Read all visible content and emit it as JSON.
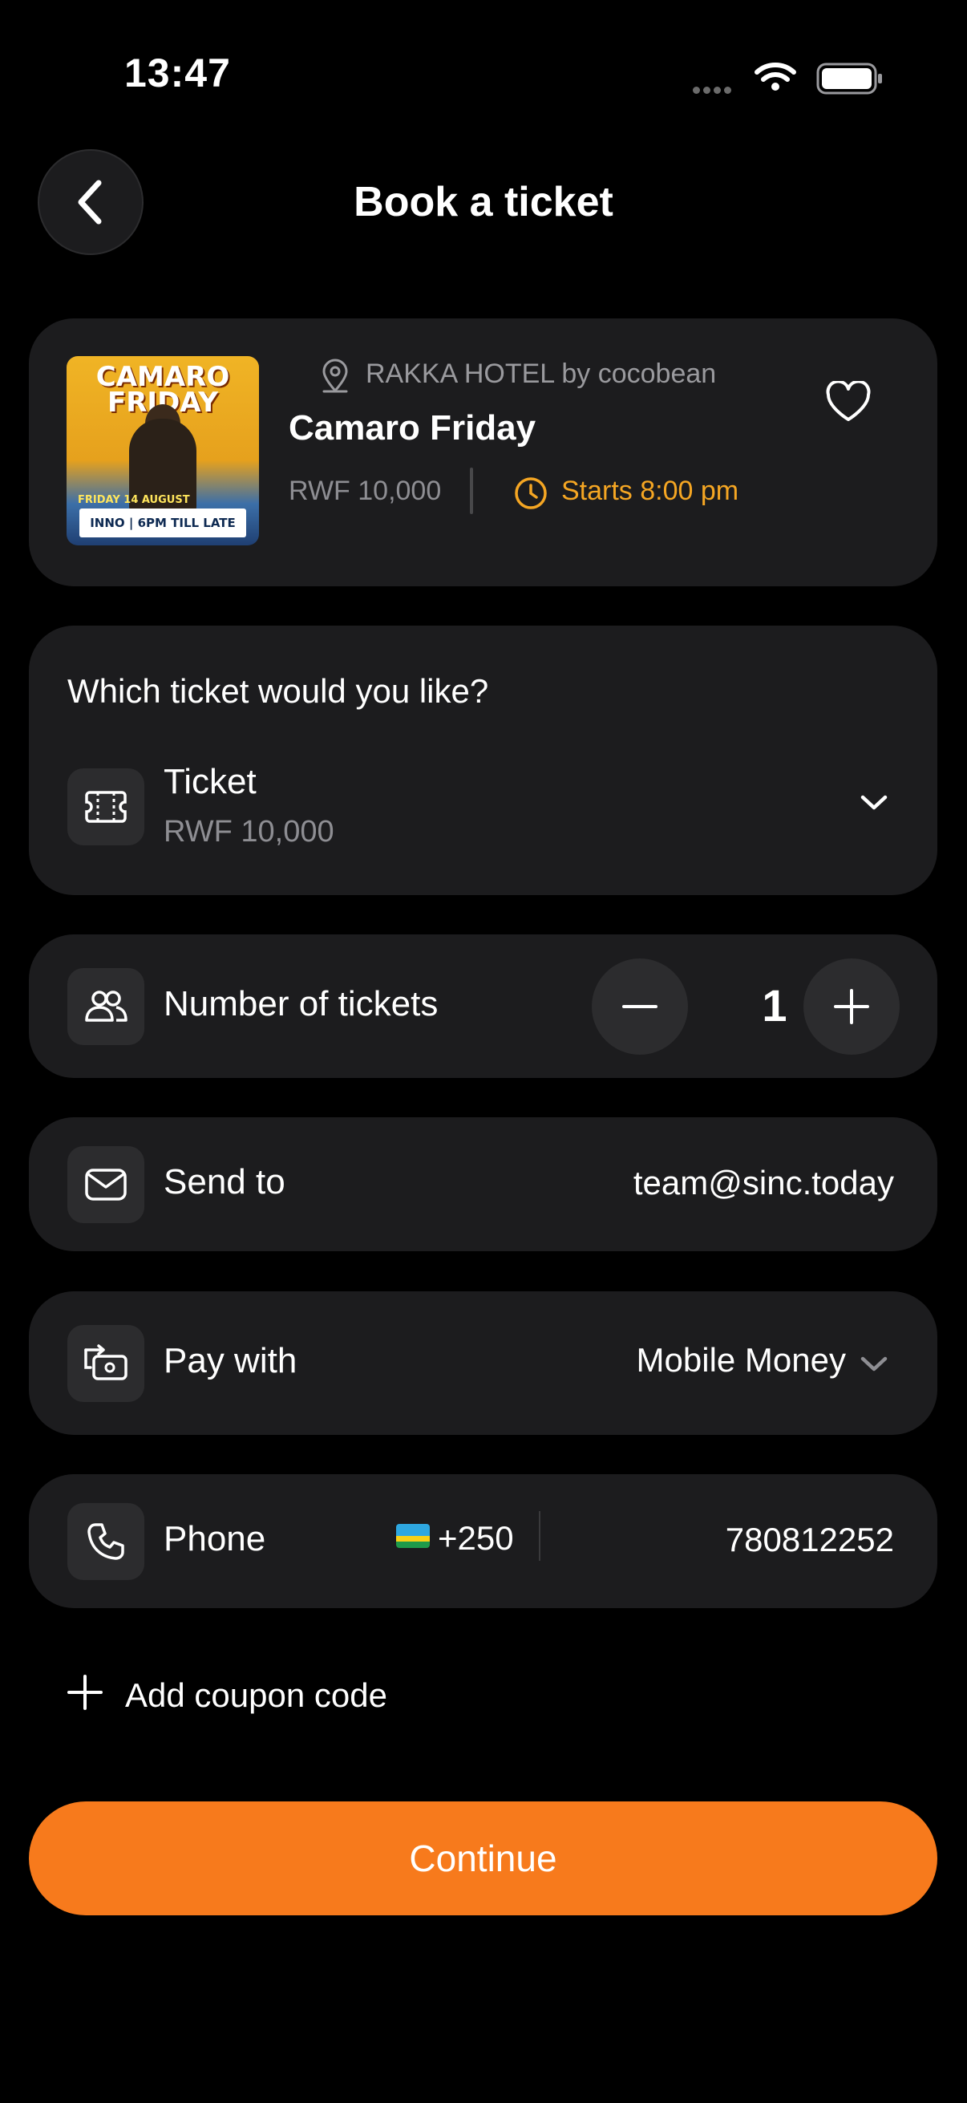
{
  "status_bar": {
    "time": "13:47"
  },
  "header": {
    "title": "Book a ticket"
  },
  "event": {
    "venue": "RAKKA HOTEL by cocobean",
    "name": "Camaro Friday",
    "price": "RWF 10,000",
    "start": "Starts 8:00 pm",
    "poster": {
      "title": "CAMARO FRIDAY",
      "date": "FRIDAY 14 AUGUST",
      "strip": "INNO | 6PM TILL LATE"
    }
  },
  "ticket_select": {
    "question": "Which ticket would you like?",
    "name": "Ticket",
    "price": "RWF 10,000"
  },
  "quantity": {
    "label": "Number of tickets",
    "value": "1"
  },
  "send_to": {
    "label": "Send to",
    "value": "team@sinc.today"
  },
  "pay_with": {
    "label": "Pay with",
    "value": "Mobile Money"
  },
  "phone": {
    "label": "Phone",
    "dial_code": "+250",
    "number": "780812252"
  },
  "coupon": {
    "label": "Add coupon code"
  },
  "continue_button": {
    "label": "Continue"
  },
  "colors": {
    "accent": "#f77a1c",
    "start_time": "#f5a623",
    "card": "#1c1c1e",
    "background": "#000000"
  },
  "icons": [
    "back-icon",
    "wifi-icon",
    "battery-icon",
    "location-pin-icon",
    "clock-icon",
    "heart-icon",
    "ticket-icon",
    "chevron-down-icon",
    "people-icon",
    "minus-icon",
    "plus-icon",
    "mail-icon",
    "wallet-icon",
    "phone-icon",
    "rwanda-flag-icon"
  ]
}
